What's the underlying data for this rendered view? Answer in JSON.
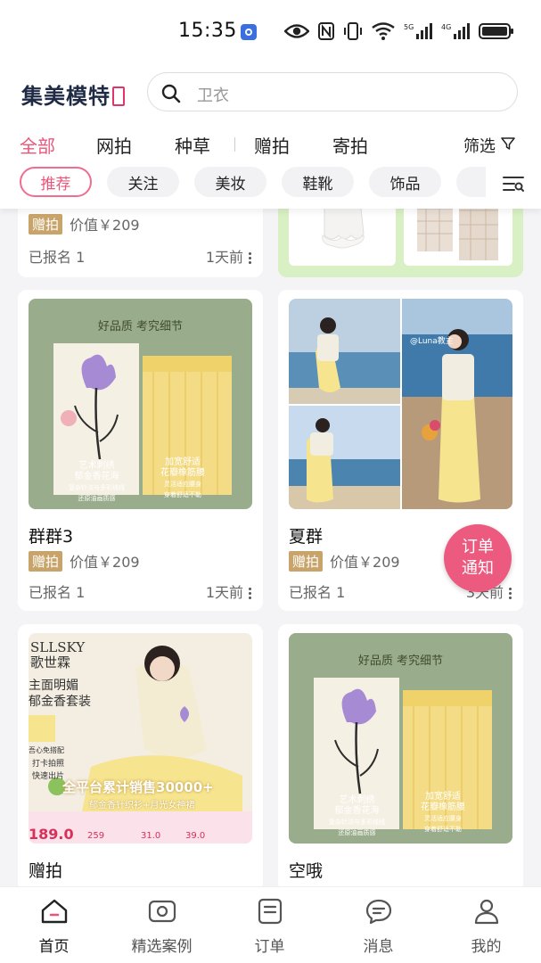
{
  "status_bar": {
    "time": "15:35"
  },
  "header": {
    "logo_text": "集美模特",
    "search_placeholder": "卫衣"
  },
  "top_tabs": [
    {
      "label": "全部",
      "active": true
    },
    {
      "label": "网拍",
      "active": false
    },
    {
      "label": "种草",
      "active": false
    },
    {
      "label": "赠拍",
      "active": false
    },
    {
      "label": "寄拍",
      "active": false
    }
  ],
  "filter_label": "筛选",
  "chips": [
    {
      "label": "推荐",
      "active": true
    },
    {
      "label": "关注",
      "active": false
    },
    {
      "label": "美妆",
      "active": false
    },
    {
      "label": "鞋靴",
      "active": false
    },
    {
      "label": "饰品",
      "active": false
    }
  ],
  "cards": [
    {
      "title": "",
      "badge": "赠拍",
      "value": "价值￥209",
      "signup": "已报名 1",
      "time": "1天前",
      "image_text": []
    },
    {
      "title": "",
      "badge": "",
      "value": "",
      "signup": "",
      "time": "",
      "image_text": []
    },
    {
      "title": "群群3",
      "badge": "赠拍",
      "value": "价值￥209",
      "signup": "已报名 1",
      "time": "1天前",
      "image_text": [
        "好品质 考究细节",
        "艺术刺绣",
        "郁金香花海",
        "复杂针法与多彩线线",
        "还原油画质感",
        "加宽舒适",
        "花瓣橡筋腰",
        "灵活适应腰身",
        "穿着舒适不勒"
      ]
    },
    {
      "title": "夏群",
      "badge": "赠拍",
      "value": "价值￥209",
      "signup": "已报名 1",
      "time": "3天前",
      "image_text": [
        "@Luna教主"
      ]
    },
    {
      "title": "赠拍",
      "badge": "",
      "value": "",
      "signup": "",
      "time": "",
      "image_text": [
        "SLLSKY",
        "歌世霖",
        "主面明媚",
        "郁金香套装",
        "吾心免搭配",
        "打卡拍照",
        "快速出片",
        "全平台累计销售30000+",
        "郁金香针织衫+月光女神裙",
        "189.0",
        "259",
        "31.0",
        "39.0"
      ]
    },
    {
      "title": "空哦",
      "badge": "",
      "value": "",
      "signup": "",
      "time": "",
      "image_text": [
        "好品质 考究细节",
        "艺术刺绣",
        "郁金香花海",
        "复杂针法与多彩线线",
        "还原油画质感",
        "加宽舒适",
        "花瓣橡筋腰",
        "灵活适应腰身",
        "穿着舒适不勒"
      ]
    }
  ],
  "order_notice": {
    "line1": "订单",
    "line2": "通知"
  },
  "bottom_nav": [
    {
      "label": "首页",
      "icon": "home-icon",
      "active": true
    },
    {
      "label": "精选案例",
      "icon": "camera-icon",
      "active": false
    },
    {
      "label": "订单",
      "icon": "order-icon",
      "active": false
    },
    {
      "label": "消息",
      "icon": "message-icon",
      "active": false
    },
    {
      "label": "我的",
      "icon": "profile-icon",
      "active": false
    }
  ],
  "colors": {
    "accent": "#e9567a",
    "badge": "#c9a46a",
    "yellow_skirt": "#f3e08a"
  }
}
